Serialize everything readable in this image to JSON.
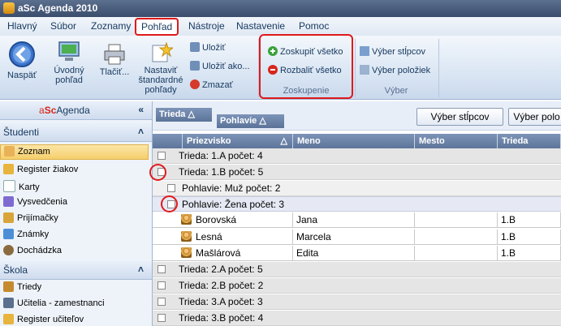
{
  "app": {
    "title": "aSc Agenda 2010"
  },
  "menu": {
    "items": [
      "Hlavný",
      "Súbor",
      "Zoznamy",
      "Pohľad",
      "Nástroje",
      "Nastavenie",
      "Pomoc"
    ]
  },
  "ribbon": {
    "naspat": "Naspäť",
    "uvodny_1": "Úvodný",
    "uvodny_2": "pohľad",
    "tlacit": "Tlačiť...",
    "nastavit_1": "Nastaviť",
    "nastavit_2": "štandardné",
    "nastavit_3": "pohľady",
    "ulozit": "Uložiť",
    "ulozit_ako": "Uložiť ako...",
    "zmazat": "Zmazať",
    "zoskupit": "Zoskupiť všetko",
    "rozbalit": "Rozbaliť všetko",
    "group_zoskupenie": "Zoskupenie",
    "vyber_stlpcov": "Výber stĺpcov",
    "vyber_poloziek": "Výber položiek",
    "group_vyber": "Výber"
  },
  "leftpane": {
    "brand_a": "a",
    "brand_sc": "Sc",
    "brand_rest": "Agenda",
    "collapse": "«",
    "studenti": "Študenti",
    "skola": "Škola",
    "studenti_items": [
      "Zoznam",
      "Register žiakov",
      "Karty",
      "Vysvedčenia",
      "Prijímačky",
      "Známky",
      "Dochádzka"
    ],
    "skola_items": [
      "Triedy",
      "Učitelia - zamestnanci",
      "Register učiteľov"
    ]
  },
  "grid": {
    "group_chip_1": "Trieda",
    "group_chip_2": "Pohlavie",
    "btn_vyber_stlpcov": "Výber stĺpcov",
    "btn_vyber_pol": "Výber polo",
    "columns": [
      "Priezvisko",
      "Meno",
      "Mesto",
      "Trieda"
    ],
    "group_rows": {
      "g1": "Trieda: 1.A počet: 4",
      "g2": "Trieda: 1.B počet: 5",
      "g2a": "Pohlavie:  Muž  počet: 2",
      "g2b": "Pohlavie:  Žena  počet: 3",
      "g3": "Trieda: 2.A počet: 5",
      "g4": "Trieda: 2.B počet: 2",
      "g5": "Trieda: 3.A počet: 3",
      "g6": "Trieda: 3.B počet: 4"
    },
    "rows": [
      {
        "priezvisko": "Borovská",
        "meno": "Jana",
        "mesto": "",
        "trieda": "1.B"
      },
      {
        "priezvisko": "Lesná",
        "meno": "Marcela",
        "mesto": "",
        "trieda": "1.B"
      },
      {
        "priezvisko": "Mašlárová",
        "meno": "Edita",
        "mesto": "",
        "trieda": "1.B"
      }
    ]
  }
}
